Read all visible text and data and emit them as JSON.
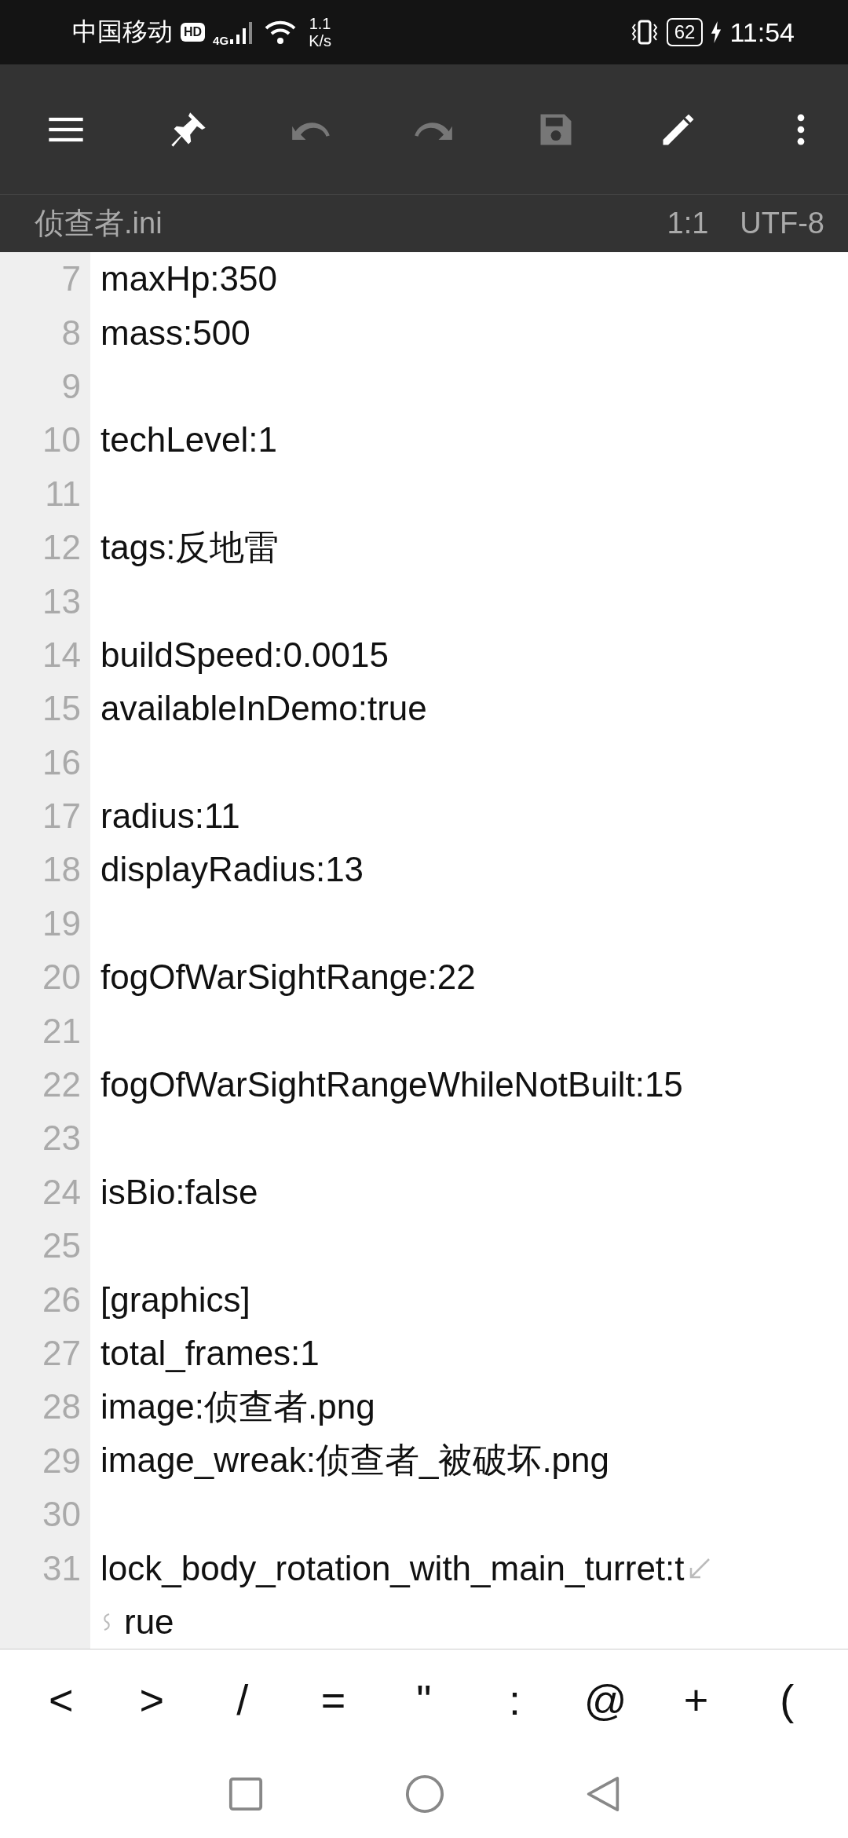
{
  "status_bar": {
    "carrier": "中国移动",
    "hd_badge": "HD",
    "network": "4G",
    "speed_value": "1.1",
    "speed_unit": "K/s",
    "battery": "62",
    "time": "11:54"
  },
  "toolbar": [
    {
      "kind": "menu",
      "disabled": false
    },
    {
      "kind": "pin",
      "disabled": false
    },
    {
      "kind": "undo",
      "disabled": true
    },
    {
      "kind": "redo",
      "disabled": true
    },
    {
      "kind": "save",
      "disabled": true
    },
    {
      "kind": "edit",
      "disabled": false
    },
    {
      "kind": "more",
      "disabled": false
    }
  ],
  "file_bar": {
    "filename": "侦查者.ini",
    "cursor": "1:1",
    "encoding": "UTF-8"
  },
  "lines": [
    {
      "number": "7",
      "text": "maxHp:350"
    },
    {
      "number": "8",
      "text": "mass:500"
    },
    {
      "number": "9"
    },
    {
      "number": "10",
      "text": "techLevel:1"
    },
    {
      "number": "11"
    },
    {
      "number": "12",
      "text": "tags:反地雷"
    },
    {
      "number": "13"
    },
    {
      "number": "14",
      "text": "buildSpeed:0.0015"
    },
    {
      "number": "15",
      "text": "availableInDemo:true"
    },
    {
      "number": "16"
    },
    {
      "number": "17",
      "text": "radius:11"
    },
    {
      "number": "18",
      "text": "displayRadius:13"
    },
    {
      "number": "19"
    },
    {
      "number": "20",
      "text": "fogOfWarSightRange:22"
    },
    {
      "number": "21"
    },
    {
      "number": "22",
      "text": "fogOfWarSightRangeWhileNotBuilt:15"
    },
    {
      "number": "23"
    },
    {
      "number": "24",
      "text": "isBio:false"
    },
    {
      "number": "25"
    },
    {
      "number": "26",
      "text": "[graphics]"
    },
    {
      "number": "27",
      "text": "total_frames:1"
    },
    {
      "number": "28",
      "text": "image:侦查者.png"
    },
    {
      "number": "29",
      "text": "image_wreak:侦查者_被破坏.png"
    },
    {
      "number": "30"
    },
    {
      "number": "31",
      "text": "lock_body_rotation_with_main_turret:t",
      "continuation": "rue"
    }
  ],
  "symbol_keys": [
    "<",
    ">",
    "/",
    "=",
    "\"",
    ":",
    "@",
    "+",
    "("
  ]
}
